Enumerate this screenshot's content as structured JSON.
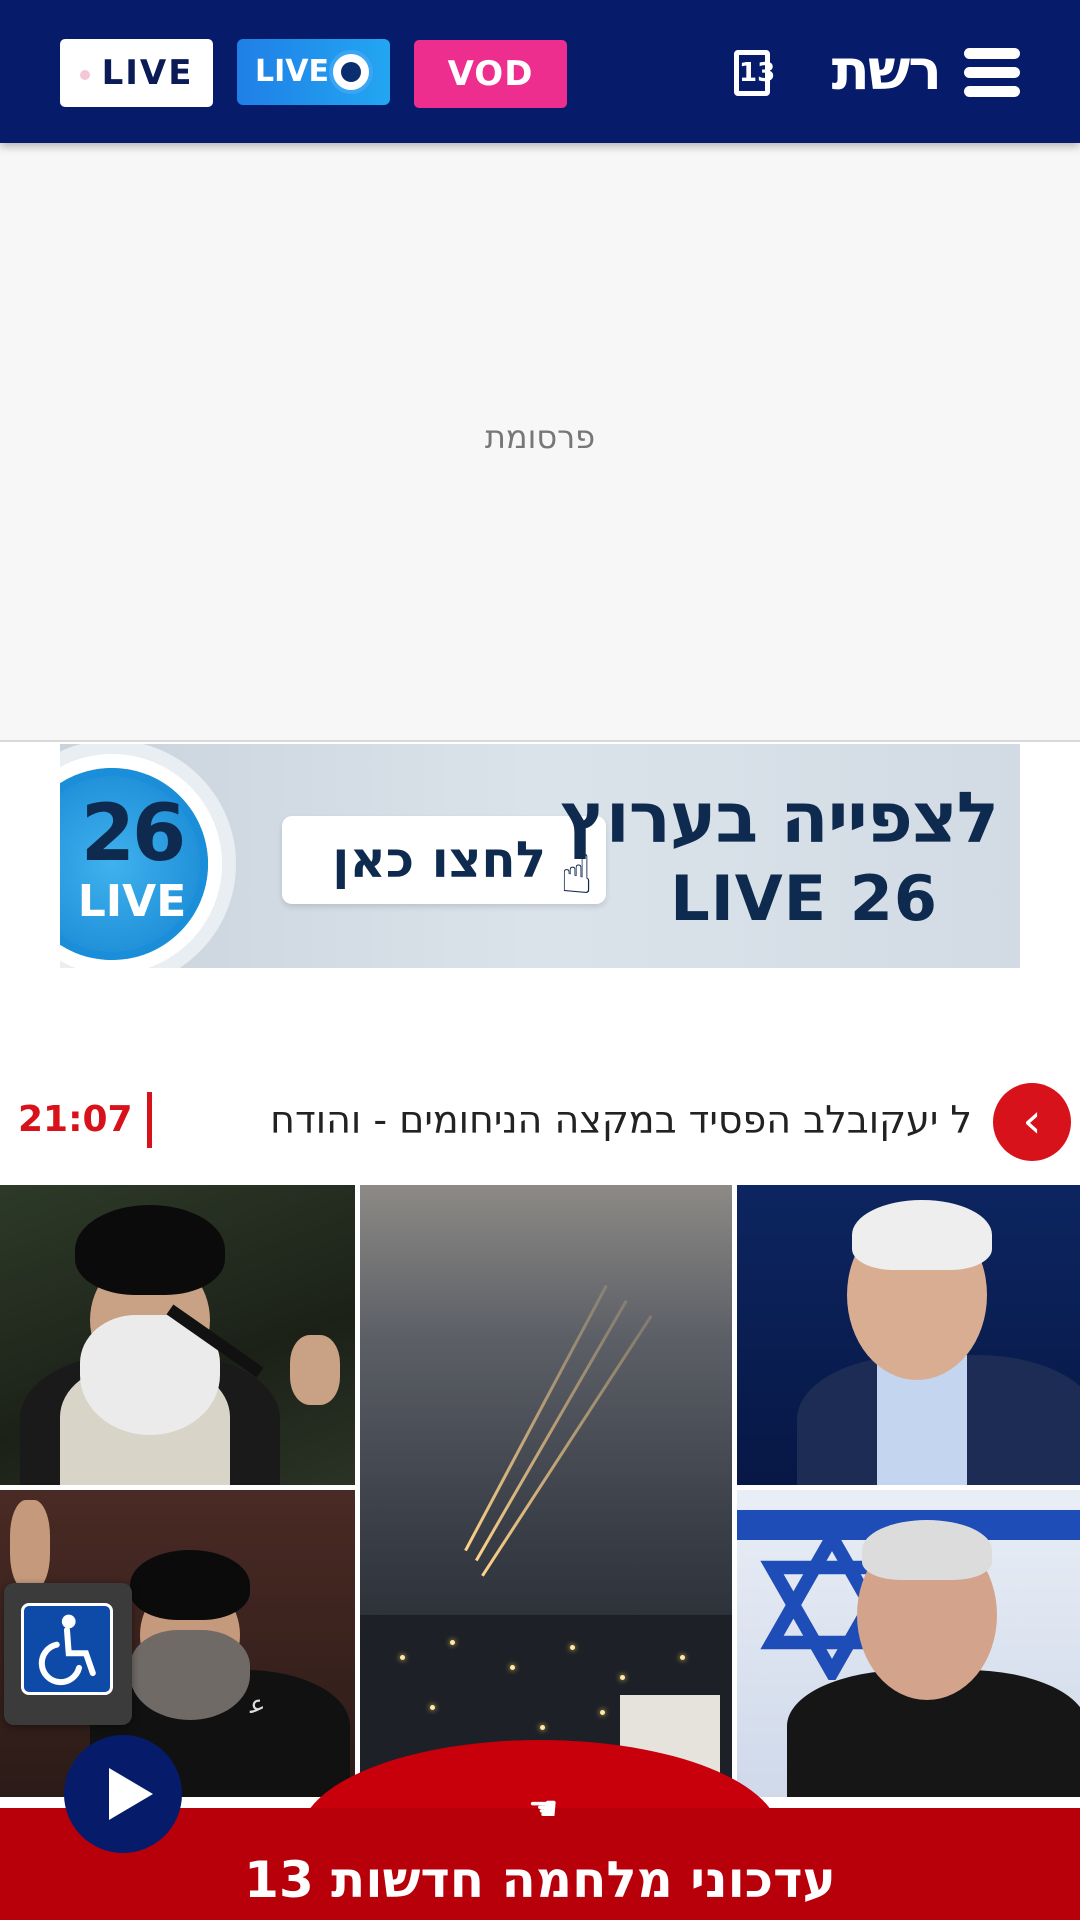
{
  "header": {
    "brand": "רשת",
    "brand_num": "13",
    "vod_label": "VOD",
    "live_eye_label": "LIVE",
    "live_label": "LIVE",
    "colors": {
      "bg": "#061c6b",
      "vod": "#ee2e8e",
      "live_eye": "#1f7fe6"
    }
  },
  "ad": {
    "label": "פרסומת"
  },
  "banner": {
    "badge_number": "26",
    "badge_text": "LIVE",
    "cta": "לחצו כאן",
    "headline_line1": "לצפייה בערוץ",
    "headline_line2": "LIVE 26"
  },
  "ticker": {
    "text": "ל יעקובלב הפסיד במקצה הניחומים - והודח",
    "time": "21:07",
    "nav_icon": "chevron-left-icon"
  },
  "bottom_banner": {
    "text": "עדכוני מלחמה חדשות 13",
    "color": "#b8000a"
  },
  "icons": {
    "menu": "hamburger-menu-icon",
    "accessibility": "wheelchair-icon",
    "play": "play-icon",
    "tap": "tap-hand-icon"
  }
}
